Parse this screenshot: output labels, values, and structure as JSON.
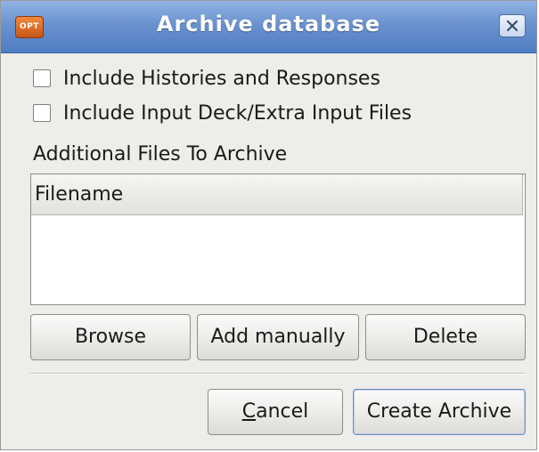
{
  "window": {
    "title": "Archive database",
    "app_icon_text": "OPT"
  },
  "options": [
    {
      "label": "Include Histories and Responses",
      "checked": false
    },
    {
      "label": "Include Input Deck/Extra Input Files",
      "checked": false
    }
  ],
  "additional_files": {
    "section_label": "Additional Files To Archive",
    "columns": [
      "Filename"
    ],
    "rows": []
  },
  "file_buttons": {
    "browse": "Browse",
    "add_manually": "Add manually",
    "delete": "Delete"
  },
  "dialog_buttons": {
    "cancel_mnemonic": "C",
    "cancel_rest": "ancel",
    "create_archive": "Create Archive"
  },
  "colors": {
    "titlebar": "#6a92cf",
    "window_bg": "#efedea",
    "default_button_border": "#6f8fc4"
  }
}
